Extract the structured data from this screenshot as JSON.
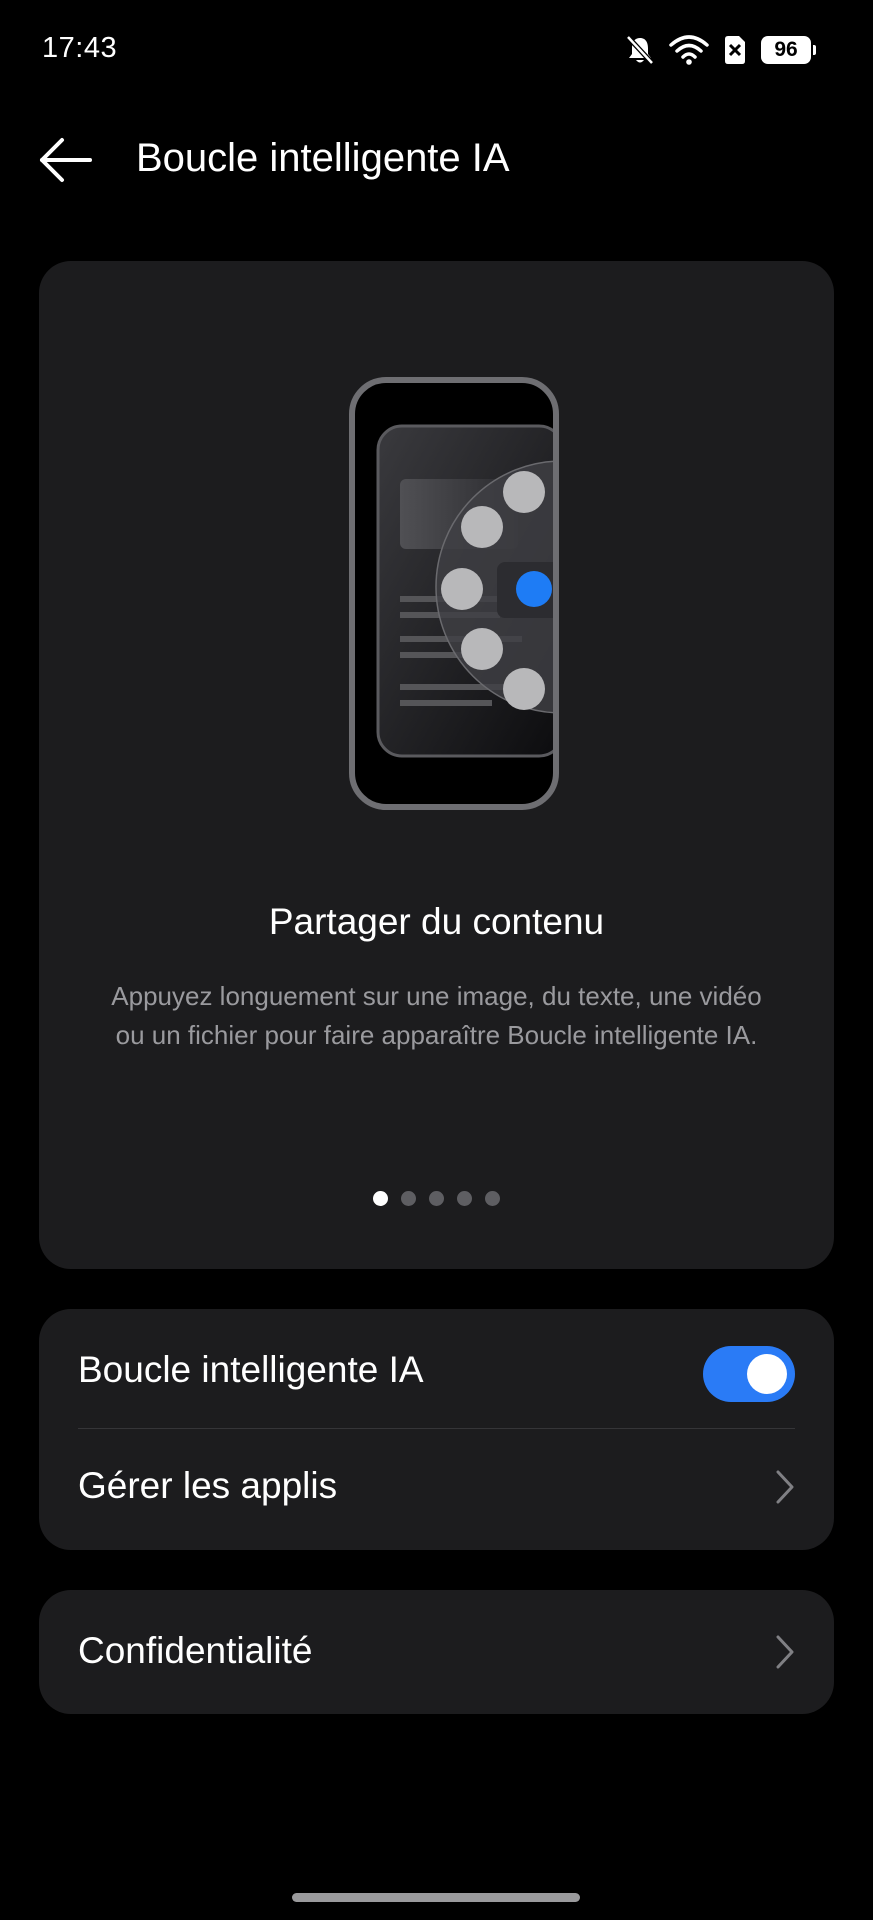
{
  "status_bar": {
    "time": "17:43",
    "battery": "96",
    "icons": [
      "bell-muted-icon",
      "wifi-icon",
      "sim-off-icon",
      "battery-icon"
    ]
  },
  "header": {
    "title": "Boucle intelligente IA",
    "back_icon": "arrow-left-icon"
  },
  "hero": {
    "title": "Partager du contenu",
    "description": "Appuyez longuement sur une image, du texte, une vidéo ou un fichier pour faire apparaître Boucle intelligente IA.",
    "page_count": 5,
    "active_page": 1
  },
  "settings": {
    "smart_loop": {
      "label": "Boucle intelligente IA",
      "enabled": true
    },
    "manage_apps": {
      "label": "Gérer les applis"
    },
    "privacy": {
      "label": "Confidentialité"
    }
  },
  "colors": {
    "background": "#000000",
    "card": "#1c1c1e",
    "accent": "#2a7bf6",
    "secondary_text": "#9a9a9e"
  }
}
